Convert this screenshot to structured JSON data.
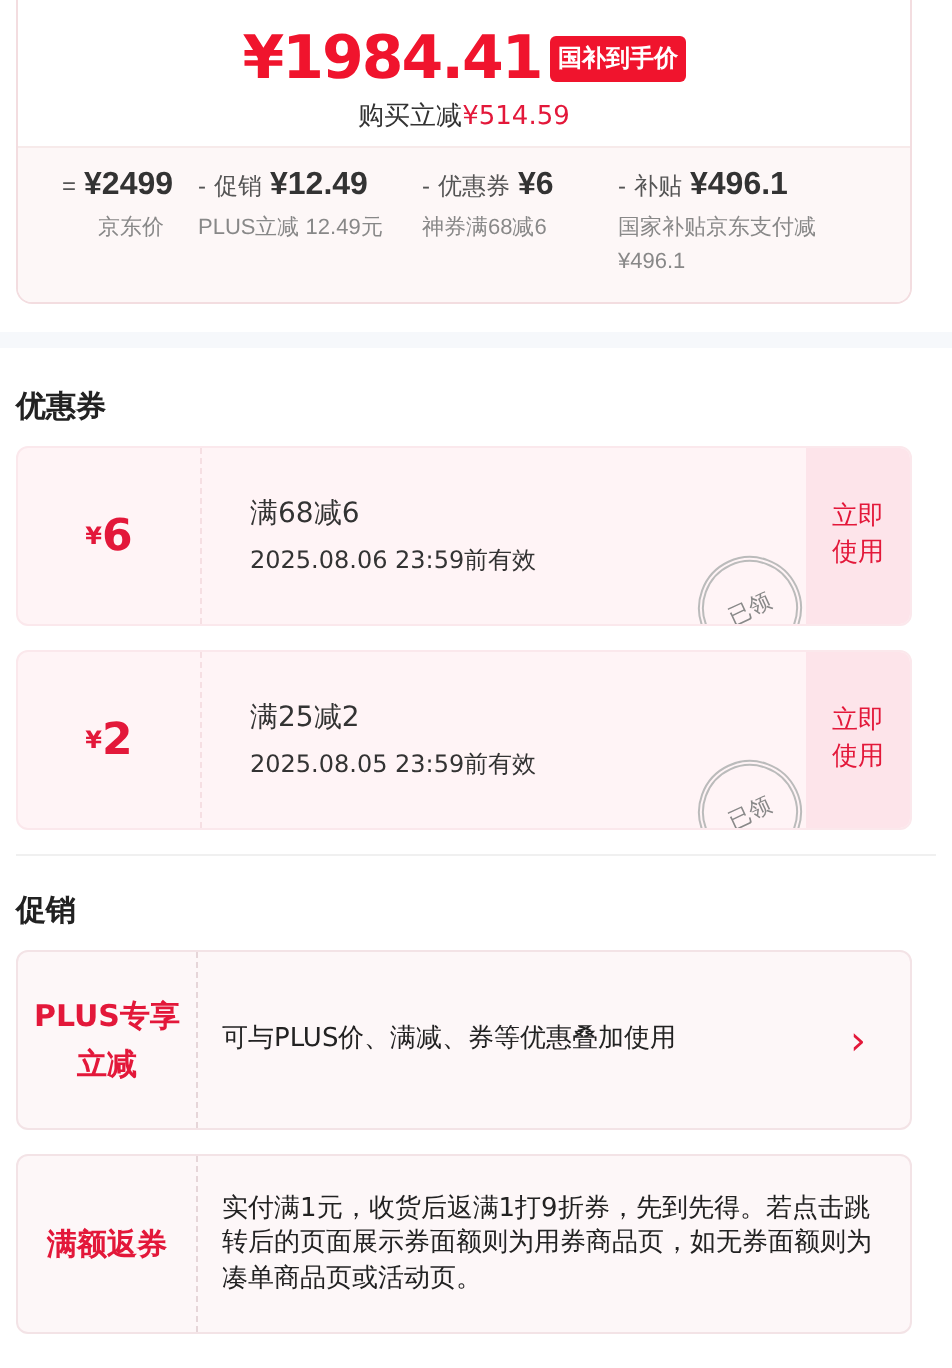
{
  "price": {
    "currency": "¥",
    "amount": "1984.41",
    "badge": "国补到手价",
    "saving_label": "购买立减",
    "saving_value": "¥514.59"
  },
  "breakdown": [
    {
      "op": "=",
      "value": "¥2499",
      "note": "京东价"
    },
    {
      "op": "-",
      "label": "促销",
      "value": "¥12.49",
      "note": "PLUS立减 12.49元"
    },
    {
      "op": "-",
      "label": "优惠券",
      "value": "¥6",
      "note": "神券满68减6"
    },
    {
      "op": "-",
      "label": "补贴",
      "value": "¥496.1",
      "note": "国家补贴京东支付减¥496.1"
    }
  ],
  "coupons_title": "优惠券",
  "coupons": [
    {
      "currency": "¥",
      "amount": "6",
      "rule": "满68减6",
      "validity": "2025.08.06 23:59前有效",
      "claimed": true,
      "stamp": "已领",
      "action": "立即使用"
    },
    {
      "currency": "¥",
      "amount": "2",
      "rule": "满25减2",
      "validity": "2025.08.05 23:59前有效",
      "claimed": true,
      "stamp": "已领",
      "action": "立即使用"
    }
  ],
  "promotions_title": "促销",
  "promotions": [
    {
      "tag": "PLUS专享立减",
      "text": "可与PLUS价、满减、券等优惠叠加使用",
      "chevron": "›"
    },
    {
      "tag": "满额返券",
      "text": "实付满1元，收货后返满1打9折券，先到先得。若点击跳转后的页面展示券面额则为用券商品页，如无券面额则为凑单商品页或活动页。"
    }
  ]
}
